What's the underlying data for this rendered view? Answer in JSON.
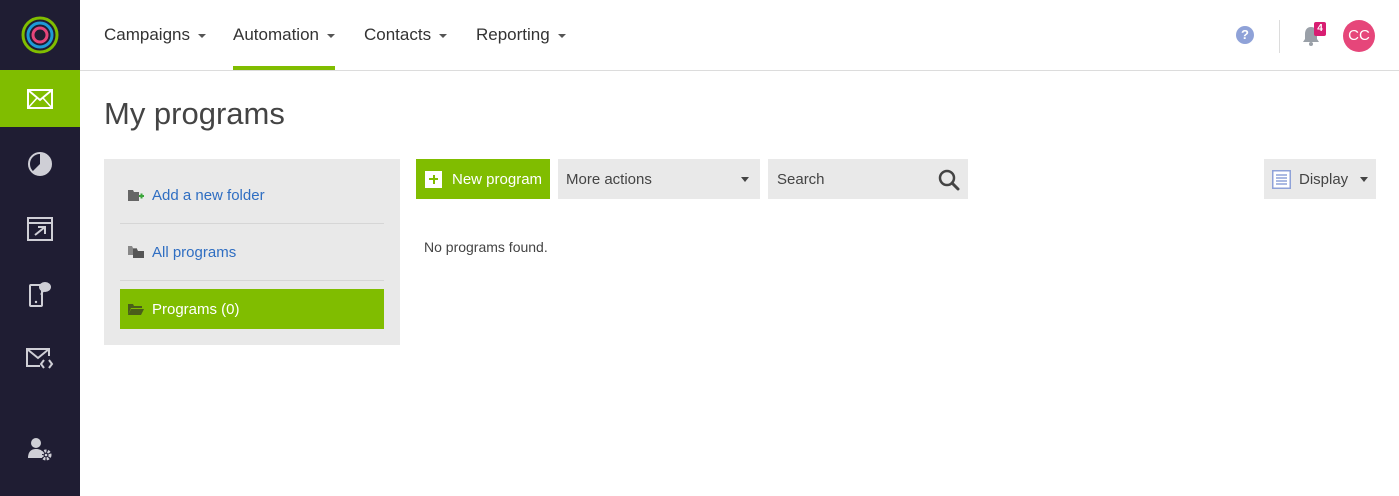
{
  "rail": {
    "items": [
      {
        "icon": "email-icon",
        "active": true
      },
      {
        "icon": "pie-chart-icon",
        "active": false
      },
      {
        "icon": "landing-page-icon",
        "active": false
      },
      {
        "icon": "mobile-message-icon",
        "active": false
      },
      {
        "icon": "email-code-icon",
        "active": false
      }
    ],
    "bottom_icon": "user-settings-icon"
  },
  "topnav": {
    "items": [
      {
        "label": "Campaigns",
        "active": false
      },
      {
        "label": "Automation",
        "active": true
      },
      {
        "label": "Contacts",
        "active": false
      },
      {
        "label": "Reporting",
        "active": false
      }
    ],
    "help_label": "?",
    "notification_count": "4",
    "avatar_initials": "CC"
  },
  "page": {
    "title": "My programs"
  },
  "folders": {
    "add_folder": "Add a new folder",
    "all_programs": "All programs",
    "programs": "Programs (0)"
  },
  "toolbar": {
    "new_program": "New program",
    "more_actions": "More actions",
    "search_placeholder": "Search",
    "display": "Display"
  },
  "content": {
    "empty_message": "No programs found."
  },
  "colors": {
    "accent": "#80bd00",
    "rail_bg": "#1f1d33",
    "link": "#2f6ec2",
    "badge": "#d81e72",
    "avatar": "#e6467a"
  }
}
